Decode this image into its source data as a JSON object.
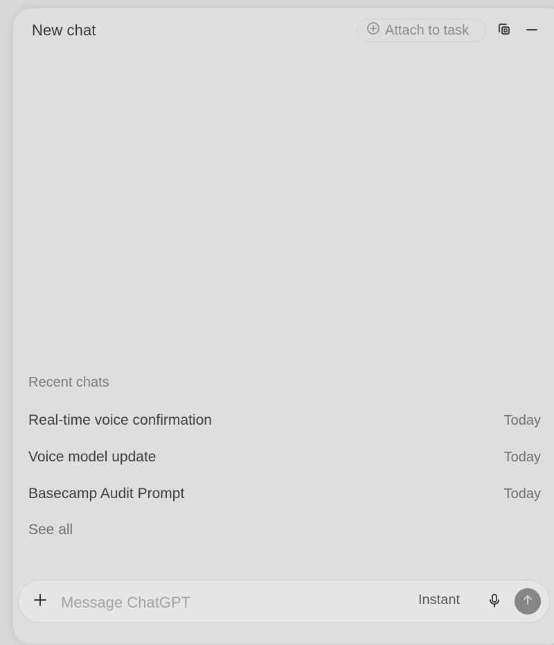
{
  "header": {
    "title": "New chat",
    "attach_label": "Attach to task",
    "icons": [
      "plus-circle-icon",
      "window-overlap-icon",
      "minimize-icon"
    ]
  },
  "recent": {
    "heading": "Recent chats",
    "items": [
      {
        "title": "Real-time voice confirmation",
        "date": "Today"
      },
      {
        "title": "Voice model update",
        "date": "Today"
      },
      {
        "title": "Basecamp Audit Prompt",
        "date": "Today"
      }
    ],
    "see_all_label": "See all"
  },
  "composer": {
    "placeholder": "Message ChatGPT",
    "value": "",
    "mode_label": "Instant",
    "icons": [
      "plus-icon",
      "microphone-icon",
      "arrow-up-icon"
    ]
  },
  "colors": {
    "background": "#dedede",
    "send_button": "#858585",
    "text_primary": "#3a3a3a",
    "text_muted": "#8c8c8c"
  }
}
